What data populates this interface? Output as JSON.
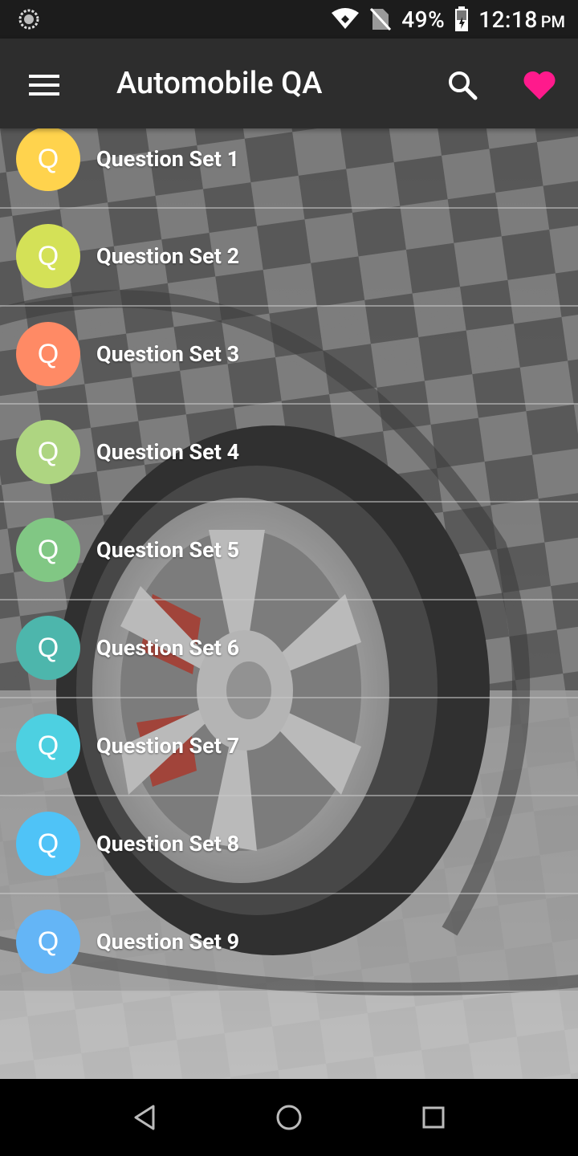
{
  "status_bar": {
    "battery": "49%",
    "time": "12:18",
    "ampm": "PM",
    "icons": [
      "loading-icon",
      "wifi-icon",
      "no-sim-icon",
      "battery-icon"
    ]
  },
  "app_bar": {
    "title": "Automobile QA",
    "icons": [
      "menu-icon",
      "search-icon",
      "heart-icon"
    ],
    "heart_color": "#ff1a8c"
  },
  "list": {
    "items": [
      {
        "letter": "Q",
        "label": "Question Set 1",
        "color": "#ffd34d"
      },
      {
        "letter": "Q",
        "label": "Question Set 2",
        "color": "#d4e157"
      },
      {
        "letter": "Q",
        "label": "Question Set 3",
        "color": "#ff8a65"
      },
      {
        "letter": "Q",
        "label": "Question Set 4",
        "color": "#aed581"
      },
      {
        "letter": "Q",
        "label": "Question Set 5",
        "color": "#81c784"
      },
      {
        "letter": "Q",
        "label": "Question Set 6",
        "color": "#4db6ac"
      },
      {
        "letter": "Q",
        "label": "Question Set 7",
        "color": "#4dd0e1"
      },
      {
        "letter": "Q",
        "label": "Question Set 8",
        "color": "#4fc3f7"
      },
      {
        "letter": "Q",
        "label": "Question Set 9",
        "color": "#64b5f6"
      }
    ]
  },
  "nav_bar": {
    "icons": [
      "back-icon",
      "home-icon",
      "recents-icon"
    ]
  }
}
